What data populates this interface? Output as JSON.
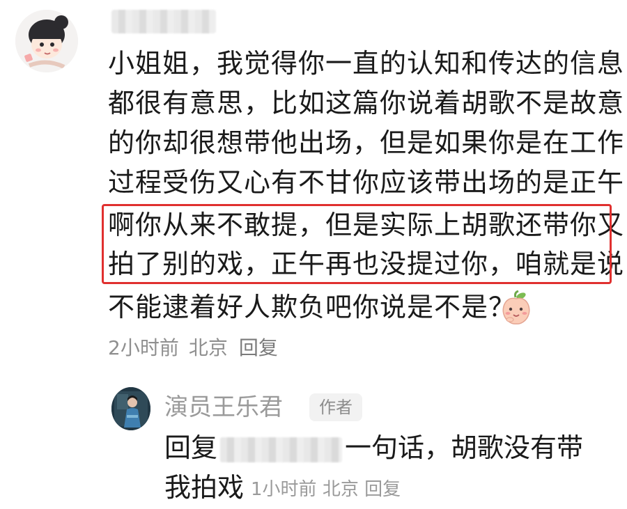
{
  "comment": {
    "lines": [
      "小姐姐，我觉得你一直的认知和传达的信息",
      "都很有意思，比如这篇你说着胡歌不是故意",
      "的你却很想带他出场，但是如果你是在工作",
      "过程受伤又心有不甘你应该带出场的是正午",
      "啊你从来不敢提，但是实际上胡歌还带你又",
      "拍了别的戏，正午再也没提过你，咱就是说",
      "不能逮着好人欺负吧你说是不是？"
    ],
    "time": "2小时前",
    "location": "北京",
    "reply_label": "回复",
    "highlight_color": "#e0302f"
  },
  "reply": {
    "author": "演员王乐君",
    "badge": "作者",
    "prefix": "回复",
    "text": "一句话，胡歌没有带",
    "text2": "我拍戏",
    "time": "1小时前",
    "location": "北京",
    "reply_label": "回复"
  }
}
